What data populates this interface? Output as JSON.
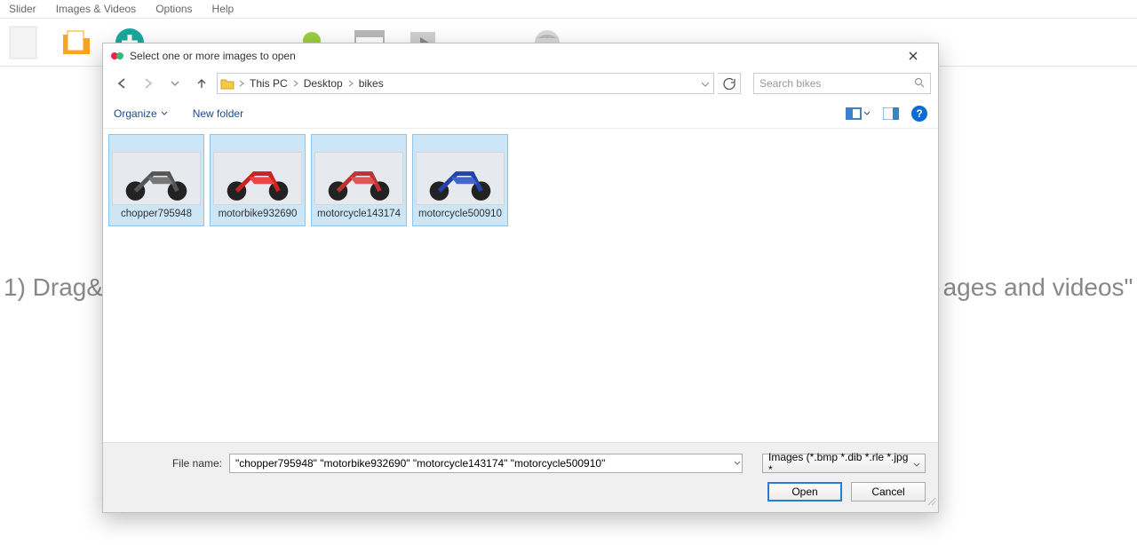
{
  "app": {
    "menu": [
      "Slider",
      "Images & Videos",
      "Options",
      "Help"
    ],
    "bg_hint_left": "1) Drag&",
    "bg_hint_right": "ages and videos\""
  },
  "dialog": {
    "title": "Select one or more images to open",
    "breadcrumbs": [
      "This PC",
      "Desktop",
      "bikes"
    ],
    "search_placeholder": "Search bikes",
    "organize_label": "Organize",
    "newfolder_label": "New folder",
    "files": [
      {
        "name": "chopper795948",
        "selected": true
      },
      {
        "name": "motorbike932690",
        "selected": true
      },
      {
        "name": "motorcycle143174",
        "selected": true
      },
      {
        "name": "motorcycle500910",
        "selected": true
      }
    ],
    "filename_label": "File name:",
    "filename_value": "\"chopper795948\" \"motorbike932690\" \"motorcycle143174\" \"motorcycle500910\"",
    "filetype_value": "Images (*.bmp *.dib *.rle *.jpg *",
    "open_label": "Open",
    "cancel_label": "Cancel"
  }
}
